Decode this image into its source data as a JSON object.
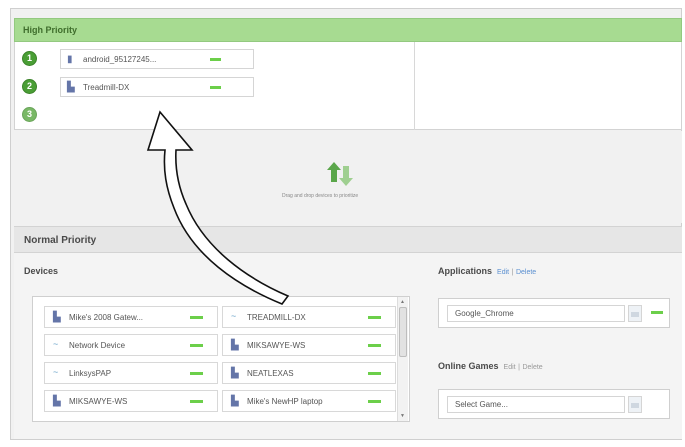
{
  "colors": {
    "high_priority_header": "#a7db91",
    "accent_green": "#6ccf4a",
    "slot_badge_green": "#4a9e35",
    "link_blue": "#5a8fd0",
    "normal_priority_header": "#e6e6e6"
  },
  "high_priority": {
    "title": "High Priority",
    "slots": [
      {
        "number": "1",
        "device_icon": "phone-icon",
        "label": "android_95127245..."
      },
      {
        "number": "2",
        "device_icon": "computer-icon",
        "label": "Treadmill-DX"
      },
      {
        "number": "3",
        "device_icon": "",
        "label": ""
      }
    ]
  },
  "drag_area": {
    "icon": "up-down-arrows-icon",
    "hint": "Drag and drop devices to prioritize"
  },
  "normal_priority": {
    "title": "Normal Priority",
    "devices": {
      "title": "Devices",
      "items": [
        {
          "icon": "computer-icon",
          "label": "Mike's 2008 Gatew..."
        },
        {
          "icon": "network-icon",
          "label": "TREADMILL-DX"
        },
        {
          "icon": "network-icon",
          "label": "Network Device"
        },
        {
          "icon": "computer-icon",
          "label": "MIKSAWYE-WS"
        },
        {
          "icon": "network-icon",
          "label": "LinksysPAP"
        },
        {
          "icon": "computer-icon",
          "label": "NEATLEXAS"
        },
        {
          "icon": "computer-icon",
          "label": "MIKSAWYE-WS"
        },
        {
          "icon": "computer-icon",
          "label": "Mike's NewHP laptop"
        }
      ]
    },
    "applications": {
      "title": "Applications",
      "edit_label": "Edit",
      "separator": "|",
      "delete_label": "Delete",
      "selected": "Google_Chrome"
    },
    "online_games": {
      "title": "Online Games",
      "edit_label": "Edit",
      "separator": "|",
      "delete_label": "Delete",
      "selected": "Select Game..."
    }
  }
}
